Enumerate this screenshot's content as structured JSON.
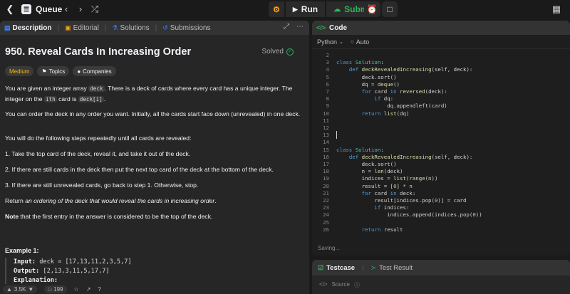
{
  "topbar": {
    "queue_label": "Queue",
    "run_label": "Run",
    "submit_label": "Submit"
  },
  "left": {
    "tabs": [
      {
        "label": "Description",
        "active": true
      },
      {
        "label": "Editorial"
      },
      {
        "label": "Solutions"
      },
      {
        "label": "Submissions"
      }
    ],
    "title": "950. Reveal Cards In Increasing Order",
    "status": "Solved",
    "badges": {
      "difficulty": "Medium",
      "topics": "Topics",
      "companies": "Companies"
    },
    "p1_a": "You are given an integer array",
    "p1_code1": "deck",
    "p1_b": ". There is a deck of cards where every card has a unique integer. The integer on the",
    "p1_sup": "ith",
    "p1_c": "card is",
    "p1_code2": "deck[i]",
    "p1_d": ".",
    "p2": "You can order the deck in any order you want. Initially, all the cards start face down (unrevealed) in one deck.",
    "p3": "You will do the following steps repeatedly until all cards are revealed:",
    "step1": "1. Take the top card of the deck, reveal it, and take it out of the deck.",
    "step2": "2. If there are still cards in the deck then put the next top card of the deck at the bottom of the deck.",
    "step3": "3. If there are still unrevealed cards, go back to step 1. Otherwise, stop.",
    "p4_a": "Return",
    "p4_em": "an ordering of the deck that would reveal the cards in increasing order",
    "p4_b": ".",
    "p5_bold": "Note",
    "p5_rest": "that the first entry in the answer is considered to be the top of the deck.",
    "example_title": "Example 1:",
    "ex_input_k": "Input:",
    "ex_input_v": "deck = [17,13,11,2,3,5,7]",
    "ex_output_k": "Output:",
    "ex_output_v": "[2,13,3,11,5,17,7]",
    "ex_expl_k": "Explanation:",
    "footer": {
      "likes": "3.5K",
      "comments": "199"
    }
  },
  "code": {
    "header": "Code",
    "language": "Python",
    "mode": "Auto",
    "status": "Saving...",
    "lines": [
      {
        "n": "2",
        "t": ""
      },
      {
        "n": "3",
        "t": "class Solution:"
      },
      {
        "n": "4",
        "t": "    def deckRevealedIncreasing(self, deck):"
      },
      {
        "n": "5",
        "t": "        deck.sort()"
      },
      {
        "n": "6",
        "t": "        dq = deque()"
      },
      {
        "n": "7",
        "t": "        for card in reversed(deck):"
      },
      {
        "n": "8",
        "t": "            if dq:"
      },
      {
        "n": "9",
        "t": "                dq.appendleft(card)"
      },
      {
        "n": "10",
        "t": "        return list(dq)"
      },
      {
        "n": "11",
        "t": ""
      },
      {
        "n": "12",
        "t": ""
      },
      {
        "n": "13",
        "t": ""
      },
      {
        "n": "14",
        "t": ""
      },
      {
        "n": "15",
        "t": "class Solution:"
      },
      {
        "n": "16",
        "t": "    def deckRevealedIncreasing(self, deck):"
      },
      {
        "n": "17",
        "t": "        deck.sort()"
      },
      {
        "n": "18",
        "t": "        n = len(deck)"
      },
      {
        "n": "19",
        "t": "        indices = list(range(n))"
      },
      {
        "n": "20",
        "t": "        result = [0] * n"
      },
      {
        "n": "21",
        "t": "        for card in deck:"
      },
      {
        "n": "22",
        "t": "            result[indices.pop(0)] = card"
      },
      {
        "n": "23",
        "t": "            if indices:"
      },
      {
        "n": "24",
        "t": "                indices.append(indices.pop(0))"
      },
      {
        "n": "25",
        "t": ""
      },
      {
        "n": "26",
        "t": "        return result"
      }
    ]
  },
  "test": {
    "tab_testcase": "Testcase",
    "tab_result": "Test Result",
    "source_label": "Source"
  },
  "colors": {
    "accent_green": "#2db55d",
    "medium": "#ffb800",
    "keyword": "#569cd6"
  }
}
